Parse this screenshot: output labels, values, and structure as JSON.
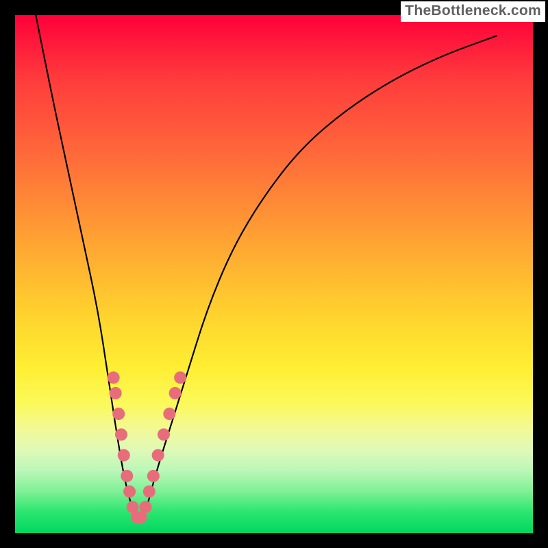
{
  "watermark": "TheBottleneck.com",
  "chart_data": {
    "type": "line",
    "title": "",
    "xlabel": "",
    "ylabel": "",
    "ylim": [
      0,
      100
    ],
    "xlim": [
      0,
      100
    ],
    "series": [
      {
        "name": "curve",
        "x": [
          4,
          7,
          10,
          13,
          16,
          18,
          19.5,
          21,
          22.5,
          24,
          25.5,
          27,
          33,
          37,
          42,
          48,
          55,
          63,
          72,
          82,
          93
        ],
        "values": [
          100,
          85,
          71,
          57,
          43,
          30,
          20,
          11,
          5,
          2,
          5,
          11,
          30,
          43,
          55,
          65,
          74,
          81,
          87,
          92,
          96
        ]
      }
    ],
    "markers": [
      {
        "name": "bead",
        "x": 19.0,
        "y": 30
      },
      {
        "name": "bead",
        "x": 19.4,
        "y": 27
      },
      {
        "name": "bead",
        "x": 20.0,
        "y": 23
      },
      {
        "name": "bead",
        "x": 20.5,
        "y": 19
      },
      {
        "name": "bead",
        "x": 21.0,
        "y": 15
      },
      {
        "name": "bead",
        "x": 21.6,
        "y": 11
      },
      {
        "name": "bead",
        "x": 22.1,
        "y": 8
      },
      {
        "name": "bead",
        "x": 22.7,
        "y": 5
      },
      {
        "name": "bead",
        "x": 23.5,
        "y": 3
      },
      {
        "name": "bead",
        "x": 24.3,
        "y": 3
      },
      {
        "name": "bead",
        "x": 25.2,
        "y": 5
      },
      {
        "name": "bead",
        "x": 25.9,
        "y": 8
      },
      {
        "name": "bead",
        "x": 26.7,
        "y": 11
      },
      {
        "name": "bead",
        "x": 27.6,
        "y": 15
      },
      {
        "name": "bead",
        "x": 28.7,
        "y": 19
      },
      {
        "name": "bead",
        "x": 29.8,
        "y": 23
      },
      {
        "name": "bead",
        "x": 30.9,
        "y": 27
      },
      {
        "name": "bead",
        "x": 31.9,
        "y": 30
      }
    ],
    "marker_color": "#e86d7b",
    "curve_color": "#000000"
  }
}
